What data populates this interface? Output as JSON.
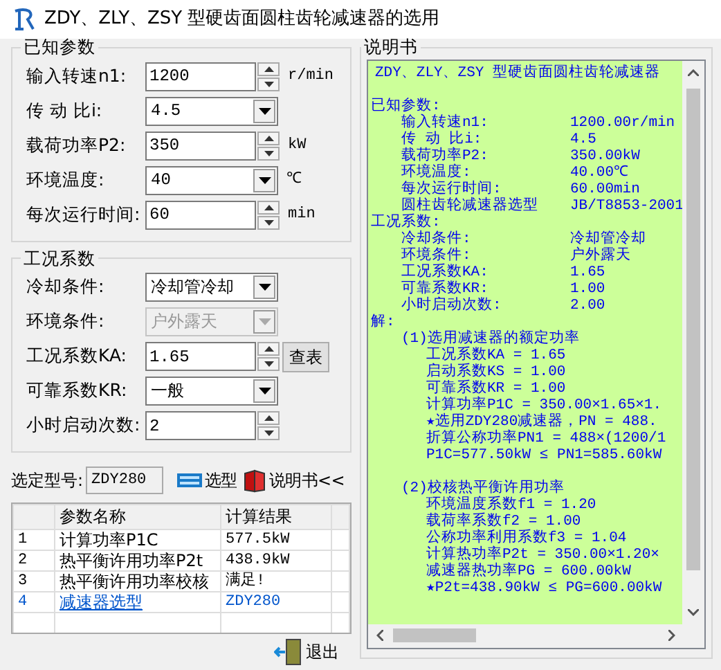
{
  "window": {
    "title": "ZDY、ZLY、ZSY 型硬齿面圆柱齿轮减速器的选用"
  },
  "known": {
    "title": "已知参数",
    "fields": [
      {
        "label": "输入转速n1:",
        "kind": "spin",
        "value": "1200",
        "unit": "r/min",
        "disabled": false
      },
      {
        "label": "传 动 比i:",
        "kind": "select",
        "value": "4.5",
        "disabled": false
      },
      {
        "label": "载荷功率P2:",
        "kind": "spin",
        "value": "350",
        "unit": "kW",
        "disabled": false
      },
      {
        "label": "环境温度:",
        "kind": "select",
        "value": "40",
        "unit": "℃",
        "disabled": false
      },
      {
        "label": "每次运行时间:",
        "kind": "spin",
        "value": "60",
        "unit": "min",
        "disabled": false
      }
    ]
  },
  "conditions": {
    "title": "工况系数",
    "fields": [
      {
        "label": "冷却条件:",
        "kind": "select",
        "value": "冷却管冷却",
        "disabled": false
      },
      {
        "label": "环境条件:",
        "kind": "select",
        "value": "户外露天",
        "disabled": true
      },
      {
        "label": "工况系数KA:",
        "kind": "spin",
        "value": "1.65",
        "button": "查表",
        "disabled": false
      },
      {
        "label": "可靠系数KR:",
        "kind": "select",
        "value": "一般",
        "disabled": false
      },
      {
        "label": "小时启动次数:",
        "kind": "spin",
        "value": "2",
        "disabled": false
      }
    ]
  },
  "selection": {
    "label": "选定型号:",
    "value": "ZDY280",
    "buttons": [
      {
        "label": "选型",
        "kind": "pick"
      },
      {
        "label": "说明书<<",
        "kind": "manual"
      }
    ]
  },
  "results": {
    "columns": [
      "参数名称",
      "计算结果"
    ],
    "rows": [
      {
        "index": "1",
        "name": "计算功率P1C",
        "value": "577.5kW",
        "selected": false
      },
      {
        "index": "2",
        "name": "热平衡许用功率P2t",
        "value": "438.9kW",
        "selected": false
      },
      {
        "index": "3",
        "name": "热平衡许用功率校核",
        "value": "满足!",
        "selected": false
      },
      {
        "index": "4",
        "name": "减速器选型",
        "value": "ZDY280",
        "selected": true
      }
    ]
  },
  "exit_button": "退出",
  "manual": {
    "title": "说明书",
    "heading": "ZDY、ZLY、ZSY 型硬齿面圆柱齿轮减速器",
    "sections": [
      {
        "text": "已知参数:",
        "children": [
          {
            "text": "输入转速n1:",
            "value": "1200.00r/min"
          },
          {
            "text": "传 动 比i:",
            "value": "4.5"
          },
          {
            "text": "载荷功率P2:",
            "value": "350.00kW"
          },
          {
            "text": "环境温度:",
            "value": "40.00℃"
          },
          {
            "text": "每次运行时间:",
            "value": "60.00min"
          },
          {
            "text": "圆柱齿轮减速器选型",
            "value": "JB/T8853-2001"
          }
        ]
      },
      {
        "text": "工况系数:",
        "children": [
          {
            "text": "冷却条件:",
            "value": "冷却管冷却"
          },
          {
            "text": "环境条件:",
            "value": "户外露天"
          },
          {
            "text": "工况系数KA:",
            "value": "1.65"
          },
          {
            "text": "可靠系数KR:",
            "value": "1.00"
          },
          {
            "text": "小时启动次数:",
            "value": "2.00"
          }
        ]
      },
      {
        "text": "解:",
        "children": [
          {
            "text": "(1)选用减速器的额定功率",
            "children": [
              {
                "text": "工况系数KA = 1.65"
              },
              {
                "text": "启动系数KS = 1.00"
              },
              {
                "text": "可靠系数KR = 1.00"
              },
              {
                "text": "计算功率P1C = 350.00×1.65×1."
              },
              {
                "text": "★选用ZDY280减速器，PN = 488."
              },
              {
                "text": "折算公称功率PN1 = 488×(1200/1"
              },
              {
                "text": "P1C=577.50kW ≤ PN1=585.60kW"
              }
            ]
          },
          {
            "text": "(2)校核热平衡许用功率",
            "children": [
              {
                "text": "环境温度系数f1 = 1.20"
              },
              {
                "text": "载荷率系数f2 = 1.00"
              },
              {
                "text": "公称功率利用系数f3 = 1.04"
              },
              {
                "text": "计算热功率P2t = 350.00×1.20×"
              },
              {
                "text": "减速器热功率PG = 600.00kW"
              },
              {
                "text": "★P2t=438.90kW ≤ PG=600.00kW"
              }
            ]
          }
        ]
      }
    ]
  }
}
